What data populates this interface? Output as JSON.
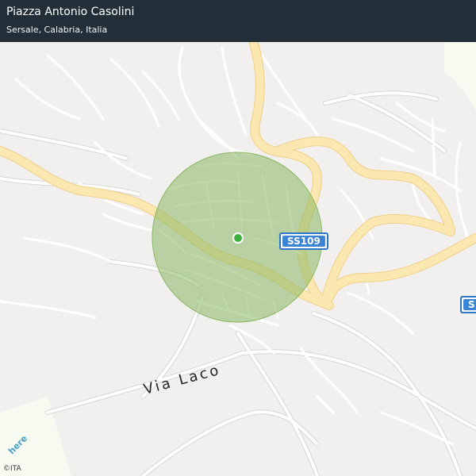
{
  "header": {
    "title": "Piazza Antonio Casolini",
    "subtitle": "Sersale, Calabria, Italia"
  },
  "map": {
    "street_label": "Via Laco",
    "road_shield": "SS109",
    "road_shield_partial": "S",
    "logo_text": "here",
    "copyright": "©ITA",
    "colors": {
      "background": "#f1f0ef",
      "local_road": "#ffffff",
      "main_road": "#fbe7b0",
      "radius_fill": "#9cc27a",
      "location_marker": "#3cae3c",
      "header_background": "#222e38",
      "shield_blue": "#3c84d6"
    }
  }
}
